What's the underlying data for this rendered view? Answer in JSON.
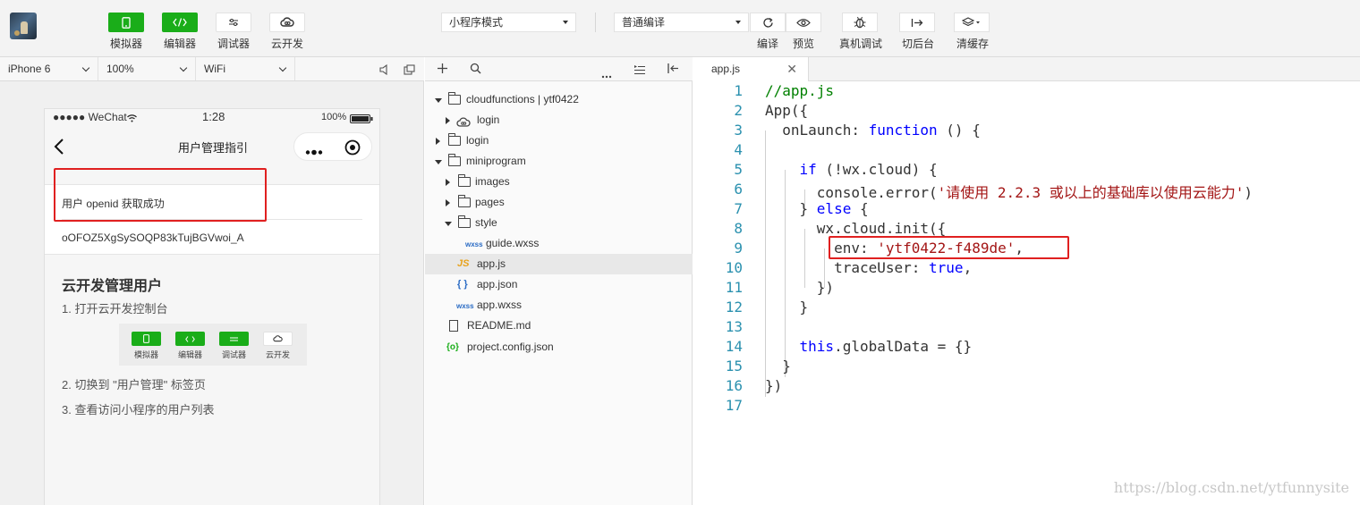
{
  "toolbar": {
    "left_buttons": [
      {
        "label": "模拟器",
        "icon": "phone-icon",
        "style": "green"
      },
      {
        "label": "编辑器",
        "icon": "code-icon",
        "style": "green"
      },
      {
        "label": "调试器",
        "icon": "debug-sliders-icon",
        "style": "white"
      },
      {
        "label": "云开发",
        "icon": "cloud-icon",
        "style": "white"
      }
    ],
    "mode_select": "小程序模式",
    "compile_select": "普通编译",
    "right_buttons": [
      {
        "label": "编译",
        "icon": "refresh-icon"
      },
      {
        "label": "预览",
        "icon": "eye-icon"
      },
      {
        "label": "真机调试",
        "icon": "bug-icon"
      },
      {
        "label": "切后台",
        "icon": "switch-background-icon"
      },
      {
        "label": "清缓存",
        "icon": "layers-icon"
      }
    ]
  },
  "subbar": {
    "device": "iPhone 6",
    "zoom": "100%",
    "network": "WiFi"
  },
  "simulator": {
    "status": {
      "carrier": "●●●●● WeChat",
      "time": "1:28",
      "battery": "100%"
    },
    "nav_title": "用户管理指引",
    "openid_status": "用户 openid 获取成功",
    "openid_value": "oOFOZ5XgSySOQP83kTujBGVwoi_A",
    "guide_title": "云开发管理用户",
    "steps": [
      "1. 打开云开发控制台",
      "2. 切换到 \"用户管理\" 标签页",
      "3. 查看访问小程序的用户列表"
    ],
    "mini_buttons": [
      "模拟器",
      "编辑器",
      "调试器",
      "云开发"
    ]
  },
  "file_tree": [
    {
      "label": "cloudfunctions | ytf0422",
      "type": "cloud-folder",
      "depth": 0,
      "open": true
    },
    {
      "label": "login",
      "type": "cloud-func",
      "depth": 1,
      "open": false
    },
    {
      "label": "login",
      "type": "folder",
      "depth": 0,
      "open": false
    },
    {
      "label": "miniprogram",
      "type": "folder",
      "depth": 0,
      "open": true
    },
    {
      "label": "images",
      "type": "folder",
      "depth": 1,
      "open": false
    },
    {
      "label": "pages",
      "type": "folder",
      "depth": 1,
      "open": false
    },
    {
      "label": "style",
      "type": "folder",
      "depth": 1,
      "open": true
    },
    {
      "label": "guide.wxss",
      "type": "wxss",
      "depth": 2
    },
    {
      "label": "app.js",
      "type": "js",
      "depth": 1,
      "selected": true
    },
    {
      "label": "app.json",
      "type": "json",
      "depth": 1
    },
    {
      "label": "app.wxss",
      "type": "wxss",
      "depth": 1
    },
    {
      "label": "README.md",
      "type": "doc",
      "depth": 0
    },
    {
      "label": "project.config.json",
      "type": "config",
      "depth": 0
    }
  ],
  "editor": {
    "tab": "app.js",
    "lines": [
      [
        [
          "c",
          "//app.js"
        ]
      ],
      [
        [
          "f",
          "App({"
        ]
      ],
      [
        [
          "f",
          "  onLaunch: "
        ],
        [
          "k",
          "function"
        ],
        [
          "f",
          " () {"
        ]
      ],
      [
        [
          "f",
          ""
        ]
      ],
      [
        [
          "f",
          "    "
        ],
        [
          "k",
          "if"
        ],
        [
          "f",
          " (!wx.cloud) {"
        ]
      ],
      [
        [
          "f",
          "      console.error("
        ],
        [
          "s",
          "'请使用 2.2.3 或以上的基础库以使用云能力'"
        ],
        [
          "f",
          ")"
        ]
      ],
      [
        [
          "f",
          "    } "
        ],
        [
          "k",
          "else"
        ],
        [
          "f",
          " {"
        ]
      ],
      [
        [
          "f",
          "      wx.cloud.init({"
        ]
      ],
      [
        [
          "f",
          "        env: "
        ],
        [
          "s",
          "'ytf0422-f489de'"
        ],
        [
          "f",
          ","
        ]
      ],
      [
        [
          "f",
          "        traceUser: "
        ],
        [
          "k",
          "true"
        ],
        [
          "f",
          ","
        ]
      ],
      [
        [
          "f",
          "      })"
        ]
      ],
      [
        [
          "f",
          "    }"
        ]
      ],
      [
        [
          "f",
          ""
        ]
      ],
      [
        [
          "f",
          "    "
        ],
        [
          "k",
          "this"
        ],
        [
          "f",
          ".globalData = {}"
        ]
      ],
      [
        [
          "f",
          "  }"
        ]
      ],
      [
        [
          "f",
          "})"
        ]
      ],
      [
        [
          "f",
          ""
        ]
      ]
    ]
  },
  "watermark": "https://blog.csdn.net/ytfunnysite",
  "colors": {
    "accent_green": "#1aad19",
    "highlight_red": "#e02020",
    "keyword": "#0000ff",
    "string": "#a31515",
    "comment": "#008000"
  }
}
